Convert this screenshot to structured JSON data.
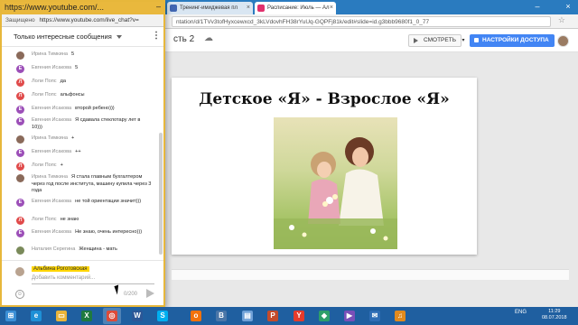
{
  "browser_tabs": [
    {
      "label": "Тренинг-имиджевая пл",
      "color": "#4267b2",
      "icon": "vk-icon"
    },
    {
      "label": "Расписание: Июль — Ал",
      "color": "#e1306c",
      "icon": "page-icon"
    }
  ],
  "address_bar": {
    "url": "ntation/d/1TVv3tofHyxcewxcd_3kLVdovhFH38rYuUq-GQPFj81k/edit#slide=id.g3bbb9680f1_0_77"
  },
  "slides": {
    "doc_title": "сть 2",
    "watch_label": "СМОТРЕТЬ",
    "share_label": "НАСТРОЙКИ ДОСТУПА",
    "slide_title": "Детское «Я» - Взрослое «Я»"
  },
  "popup": {
    "title": "https://www.youtube.com/...",
    "secure_label": "Защищено",
    "url": "https://www.youtube.com/live_chat?v=",
    "chat_filter": "Только интересные сообщения"
  },
  "messages": [
    {
      "author": "Ирина Тимкина",
      "text": "5",
      "initial": "",
      "color": "#8a6a5a"
    },
    {
      "author": "Евгения Исакова",
      "text": "5",
      "initial": "Е",
      "color": "#9c4fb8"
    },
    {
      "author": "Лоли Попс",
      "text": "да",
      "initial": "Л",
      "color": "#e04a4a"
    },
    {
      "author": "Лоли Попс",
      "text": "альфонсы",
      "initial": "Л",
      "color": "#e04a4a"
    },
    {
      "author": "Евгения Исакова",
      "text": "второй ребено)))",
      "initial": "Е",
      "color": "#9c4fb8"
    },
    {
      "author": "Евгения Исакова",
      "text": "Я сдавала стеклотару лет в 10)))",
      "initial": "Е",
      "color": "#9c4fb8"
    },
    {
      "author": "Ирина Тимкина",
      "text": "+",
      "initial": "",
      "color": "#8a6a5a"
    },
    {
      "author": "Евгения Исакова",
      "text": "++",
      "initial": "Е",
      "color": "#9c4fb8"
    },
    {
      "author": "Лоли Попс",
      "text": "+",
      "initial": "Л",
      "color": "#e04a4a"
    },
    {
      "author": "Ирина Тимкина",
      "text": "Я стала главным бухгалтером через год после института, машину купила через 3 года",
      "initial": "",
      "color": "#8a6a5a"
    },
    {
      "author": "Евгения Исакова",
      "text": "не той ориентации значит)))",
      "initial": "Е",
      "color": "#9c4fb8"
    },
    {
      "author": "Лоли Попс",
      "text": "не знаю",
      "initial": "Л",
      "color": "#e04a4a"
    },
    {
      "author": "Евгения Исакова",
      "text": "Не знаю, очень интересно)))",
      "initial": "Е",
      "color": "#9c4fb8"
    },
    {
      "author": "Наталия Серегина",
      "text": "Женщина - мать",
      "initial": "",
      "color": "#7a8a5a"
    }
  ],
  "input": {
    "user_name": "Альбина Роготовская",
    "placeholder": "Добавить комментарий...",
    "counter": "0/200"
  },
  "tray": {
    "lang": "ENG",
    "time": "11:29",
    "date": "08.07.2018"
  }
}
